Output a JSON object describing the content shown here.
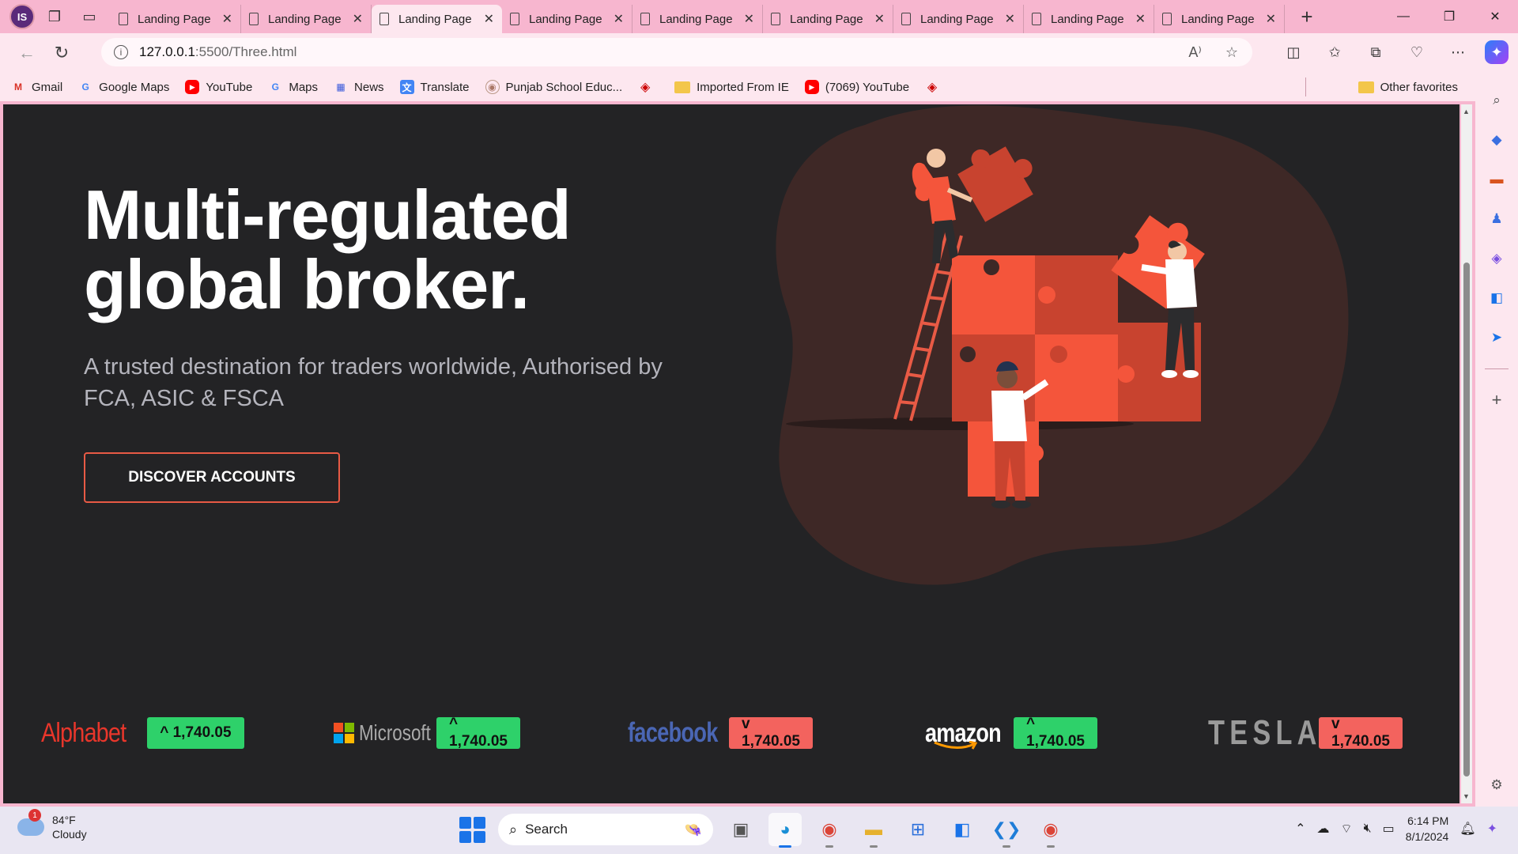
{
  "browser": {
    "profile_initials": "IS",
    "tabs": [
      {
        "title": "Landing Page"
      },
      {
        "title": "Landing Page"
      },
      {
        "title": "Landing Page"
      },
      {
        "title": "Landing Page"
      },
      {
        "title": "Landing Page"
      },
      {
        "title": "Landing Page"
      },
      {
        "title": "Landing Page"
      },
      {
        "title": "Landing Page"
      },
      {
        "title": "Landing Page"
      }
    ],
    "active_tab_index": 2,
    "url_host": "127.0.0.1",
    "url_path": ":5500/Three.html",
    "bookmarks": [
      {
        "label": "Gmail",
        "icon": "gmail-icon"
      },
      {
        "label": "Google Maps",
        "icon": "google-icon"
      },
      {
        "label": "YouTube",
        "icon": "youtube-icon"
      },
      {
        "label": "Maps",
        "icon": "google-icon"
      },
      {
        "label": "News",
        "icon": "news-icon"
      },
      {
        "label": "Translate",
        "icon": "translate-icon"
      },
      {
        "label": "Punjab School Educ...",
        "icon": "punjab-school-icon"
      },
      {
        "label": "",
        "icon": "red-diamond-icon"
      },
      {
        "label": "Imported From IE",
        "icon": "folder-icon"
      },
      {
        "label": "(7069) YouTube",
        "icon": "youtube-icon"
      },
      {
        "label": "",
        "icon": "red-diamond-icon"
      }
    ],
    "other_favorites": "Other favorites"
  },
  "hero": {
    "title_line1": "Multi-regulated",
    "title_line2": "global broker.",
    "subtitle": "A trusted destination for traders worldwide, Authorised by FCA, ASIC & FSCA",
    "cta": "DISCOVER ACCOUNTS"
  },
  "tickers": [
    {
      "company": "Alphabet",
      "badge": "^ 1,740.05",
      "direction": "up"
    },
    {
      "company": "Microsoft",
      "badge": "^ 1,740.05",
      "direction": "up"
    },
    {
      "company": "facebook",
      "badge": "v 1,740.05",
      "direction": "down"
    },
    {
      "company": "amazon",
      "badge": "^ 1,740.05",
      "direction": "up"
    },
    {
      "company": "TESLA",
      "badge": "v 1,740.05",
      "direction": "down"
    }
  ],
  "colors": {
    "page_bg": "#232325",
    "accent": "#e85a45",
    "up": "#2ed16a",
    "down": "#f3635e",
    "blob": "#3e2826"
  },
  "taskbar": {
    "weather_badge": "1",
    "temperature": "84°F",
    "condition": "Cloudy",
    "search_label": "Search",
    "time": "6:14 PM",
    "date": "8/1/2024"
  }
}
